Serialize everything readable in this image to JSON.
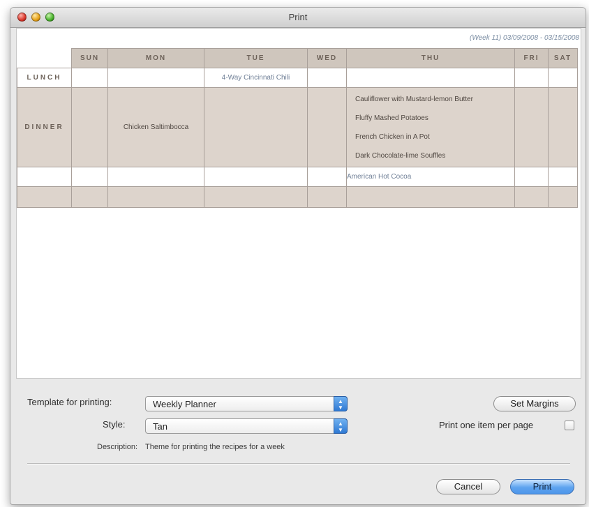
{
  "window": {
    "title": "Print"
  },
  "preview": {
    "week_range": "(Week 11) 03/09/2008 - 03/15/2008",
    "days": [
      "SUN",
      "MON",
      "TUE",
      "WED",
      "THU",
      "FRI",
      "SAT"
    ],
    "rows": {
      "lunch": {
        "label": "LUNCH",
        "tue": "4-Way Cincinnati Chili"
      },
      "dinner": {
        "label": "DINNER",
        "mon": "Chicken Saltimbocca",
        "thu": [
          "Cauliflower with Mustard-lemon Butter",
          "Fluffy Mashed Potatoes",
          "French Chicken in A Pot",
          "Dark Chocolate-lime Souffles"
        ]
      },
      "extra": {
        "thu": "American Hot Cocoa"
      }
    }
  },
  "controls": {
    "template_label": "Template for printing:",
    "template_value": "Weekly Planner",
    "style_label": "Style:",
    "style_value": "Tan",
    "description_label": "Description:",
    "description_value": "Theme for printing the recipes for a week",
    "set_margins": "Set Margins",
    "one_per_page_label": "Print one item per page",
    "one_per_page_checked": false,
    "cancel": "Cancel",
    "print": "Print"
  },
  "colors": {
    "tan_header": "#cfc6bd",
    "tan_row": "#ddd4cc",
    "link_text": "#6f7f96",
    "primary_button": "#4e96ea"
  }
}
